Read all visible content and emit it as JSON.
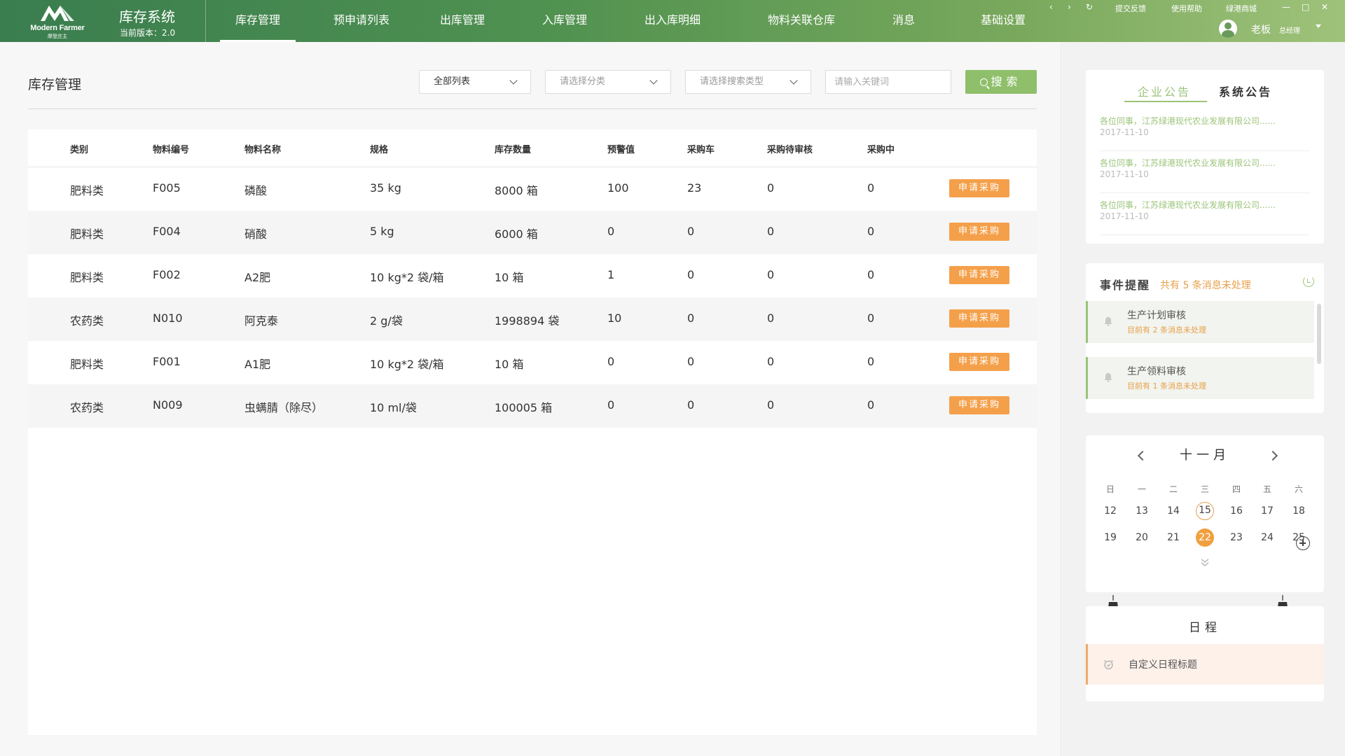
{
  "header": {
    "logo_en": "Modern Farmer",
    "logo_cn": "摩登庄主",
    "system_title": "库存系统",
    "version": "当前版本：2.0",
    "nav": [
      {
        "label": "库存管理",
        "active": true
      },
      {
        "label": "预申请列表",
        "active": false
      },
      {
        "label": "出库管理",
        "active": false
      },
      {
        "label": "入库管理",
        "active": false
      },
      {
        "label": "出入库明细",
        "active": false
      },
      {
        "label": "物料关联仓库",
        "active": false
      },
      {
        "label": "消息",
        "active": false
      },
      {
        "label": "基础设置",
        "active": false
      }
    ],
    "window_controls": {
      "back": "‹",
      "forward": "›",
      "refresh": "↻",
      "minimize": "—",
      "maximize": "□",
      "close": "✕"
    },
    "links": {
      "feedback": "提交反馈",
      "help": "使用帮助",
      "mall": "绿港商城"
    },
    "user": {
      "name": "老板",
      "role": "总经理"
    }
  },
  "main": {
    "title": "库存管理",
    "filters": {
      "list_type": "全部列表",
      "category_placeholder": "请选择分类",
      "search_type_placeholder": "请选择搜索类型",
      "keyword_placeholder": "请输入关键词",
      "search_label": "搜索"
    },
    "table": {
      "columns": [
        "类别",
        "物料编号",
        "物料名称",
        "规格",
        "库存数量",
        "预警值",
        "采购车",
        "采购待审核",
        "采购中"
      ],
      "action_label": "申请采购",
      "rows": [
        [
          "肥料类",
          "F005",
          "磷酸",
          "35 kg",
          "8000 箱",
          "100",
          "23",
          "0",
          "0"
        ],
        [
          "肥料类",
          "F004",
          "硝酸",
          "5 kg",
          "6000 箱",
          "0",
          "0",
          "0",
          "0"
        ],
        [
          "肥料类",
          "F002",
          "A2肥",
          "10 kg*2 袋/箱",
          "10 箱",
          "1",
          "0",
          "0",
          "0"
        ],
        [
          "农药类",
          "N010",
          "阿克泰",
          "2 g/袋",
          "1998894 袋",
          "10",
          "0",
          "0",
          "0"
        ],
        [
          "肥料类",
          "F001",
          "A1肥",
          "10 kg*2 袋/箱",
          "10 箱",
          "0",
          "0",
          "0",
          "0"
        ],
        [
          "农药类",
          "N009",
          "虫螨腈（除尽）",
          "10 ml/袋",
          "100005 箱",
          "0",
          "0",
          "0",
          "0"
        ]
      ]
    }
  },
  "sidebar": {
    "notice": {
      "tabs": [
        {
          "label": "企业公告",
          "active": true
        },
        {
          "label": "系统公告",
          "active": false
        }
      ],
      "items": [
        {
          "text": "各位同事，江苏绿港现代农业发展有限公司......",
          "date": "2017-11-10"
        },
        {
          "text": "各位同事，江苏绿港现代农业发展有限公司......",
          "date": "2017-11-10"
        },
        {
          "text": "各位同事，江苏绿港现代农业发展有限公司......",
          "date": "2017-11-10"
        }
      ]
    },
    "events": {
      "title": "事件提醒",
      "summary": "共有 5 条消息未处理",
      "items": [
        {
          "name": "生产计划审核",
          "count": "目前有  2  条消息未处理"
        },
        {
          "name": "生产领料审核",
          "count": "目前有  1  条消息未处理"
        }
      ]
    },
    "calendar": {
      "month": "十一月",
      "weekdays": [
        "日",
        "一",
        "二",
        "三",
        "四",
        "五",
        "六"
      ],
      "weeks": [
        [
          "12",
          "13",
          "14",
          "15",
          "16",
          "17",
          "18"
        ],
        [
          "19",
          "20",
          "21",
          "22",
          "23",
          "24",
          "25"
        ]
      ],
      "today": "15",
      "selected": "22"
    },
    "schedule": {
      "title": "日程",
      "item": "自定义日程标题"
    }
  },
  "colors": {
    "brand_green": "#4f9150",
    "accent_green": "#9bc47a",
    "accent_orange": "#f4a04a"
  }
}
